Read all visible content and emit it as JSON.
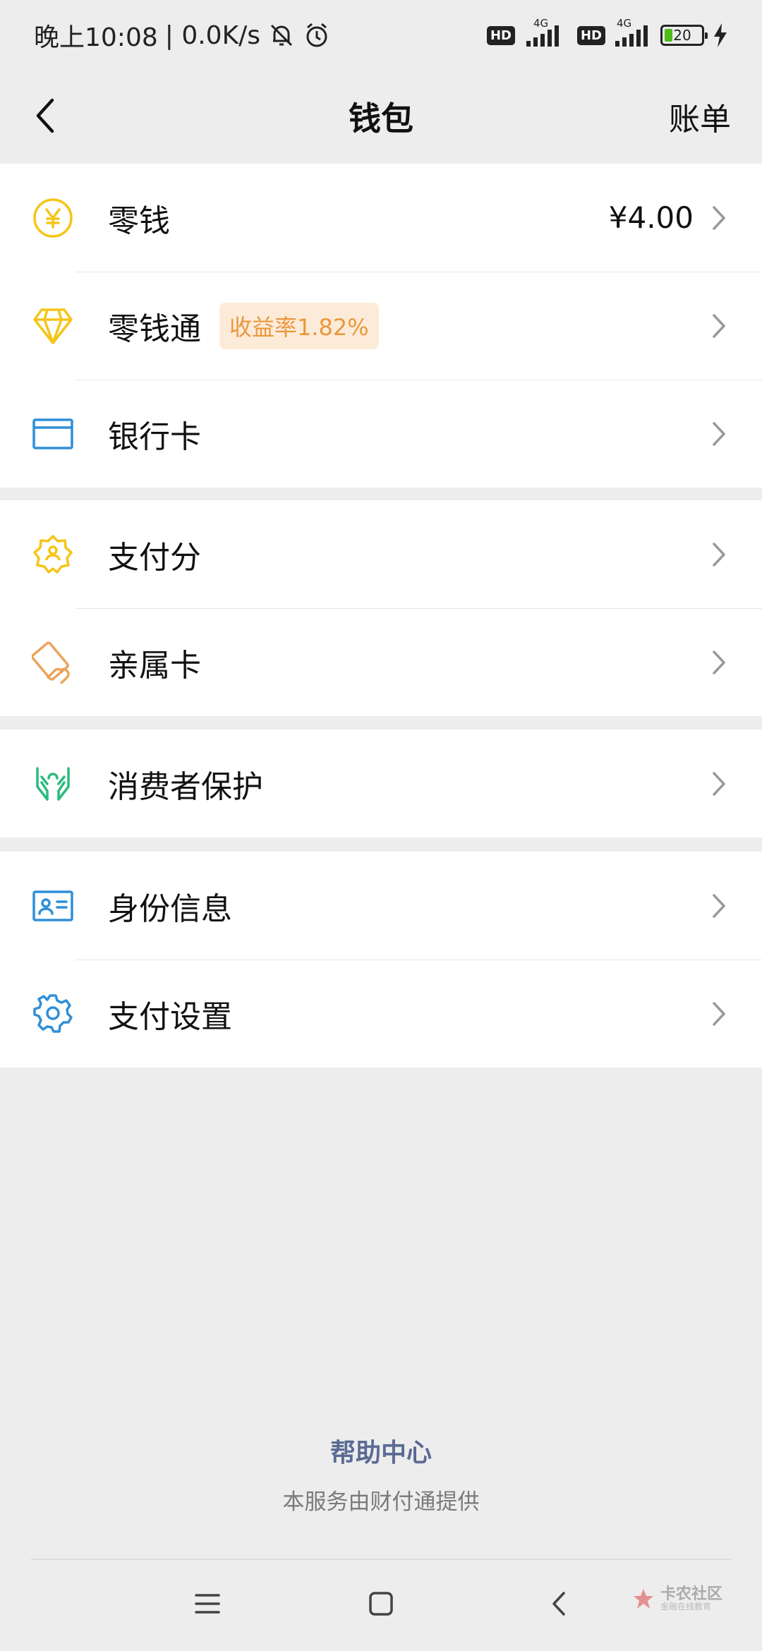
{
  "status_bar": {
    "time": "晚上10:08",
    "speed": "| 0.0K/s",
    "sim1_label": "HD",
    "sim1_net": "4G",
    "sim2_label": "HD",
    "sim2_net": "4G",
    "battery": "20"
  },
  "header": {
    "title": "钱包",
    "bill_label": "账单"
  },
  "group1": [
    {
      "label": "零钱",
      "value": "¥4.00",
      "icon": "yuan-coin-icon"
    },
    {
      "label": "零钱通",
      "badge": "收益率1.82%",
      "icon": "diamond-icon"
    },
    {
      "label": "银行卡",
      "icon": "bank-card-icon"
    }
  ],
  "group2": [
    {
      "label": "支付分",
      "icon": "pay-score-icon"
    },
    {
      "label": "亲属卡",
      "icon": "family-card-icon"
    }
  ],
  "group3": [
    {
      "label": "消费者保护",
      "icon": "protection-hands-icon"
    }
  ],
  "group4": [
    {
      "label": "身份信息",
      "icon": "id-card-icon"
    },
    {
      "label": "支付设置",
      "icon": "gear-icon"
    }
  ],
  "footer": {
    "help_center": "帮助中心",
    "service_note": "本服务由财付通提供"
  },
  "watermark": {
    "main": "卡农社区",
    "sub": "金融在线教育"
  },
  "colors": {
    "background": "#ededed",
    "coin_yellow": "#f5c518",
    "badge_bg": "#fdebd9",
    "badge_text": "#e9983c",
    "blue_icon": "#2f8fd8",
    "green_icon": "#2bba7e",
    "orange_icon": "#eba45a",
    "help_link": "#5a6b94"
  }
}
